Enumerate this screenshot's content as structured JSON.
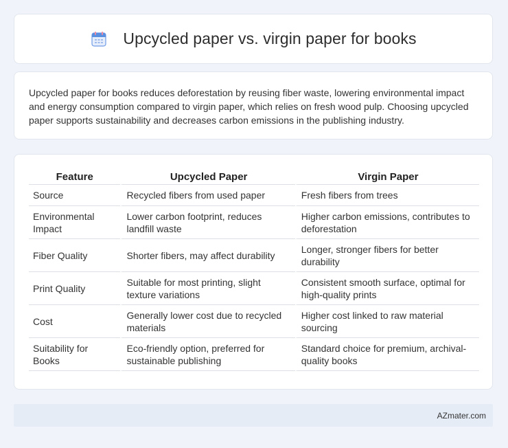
{
  "header": {
    "icon": "calendar-icon",
    "title": "Upcycled paper vs. virgin paper for books"
  },
  "intro": {
    "text": "Upcycled paper for books reduces deforestation by reusing fiber waste, lowering environmental impact and energy consumption compared to virgin paper, which relies on fresh wood pulp. Choosing upcycled paper supports sustainability and decreases carbon emissions in the publishing industry."
  },
  "table": {
    "headers": [
      "Feature",
      "Upcycled Paper",
      "Virgin Paper"
    ],
    "rows": [
      [
        "Source",
        "Recycled fibers from used paper",
        "Fresh fibers from trees"
      ],
      [
        "Environmental Impact",
        "Lower carbon footprint, reduces landfill waste",
        "Higher carbon emissions, contributes to deforestation"
      ],
      [
        "Fiber Quality",
        "Shorter fibers, may affect durability",
        "Longer, stronger fibers for better durability"
      ],
      [
        "Print Quality",
        "Suitable for most printing, slight texture variations",
        "Consistent smooth surface, optimal for high-quality prints"
      ],
      [
        "Cost",
        "Generally lower cost due to recycled materials",
        "Higher cost linked to raw material sourcing"
      ],
      [
        "Suitability for Books",
        "Eco-friendly option, preferred for sustainable publishing",
        "Standard choice for premium, archival-quality books"
      ]
    ]
  },
  "footer": {
    "text": "AZmater.com"
  },
  "colors": {
    "background": "#f0f4fa",
    "card": "#ffffff",
    "footer": "#e6ecf6",
    "icon_blue": "#5b8fe0",
    "icon_pink": "#f08a9c"
  }
}
